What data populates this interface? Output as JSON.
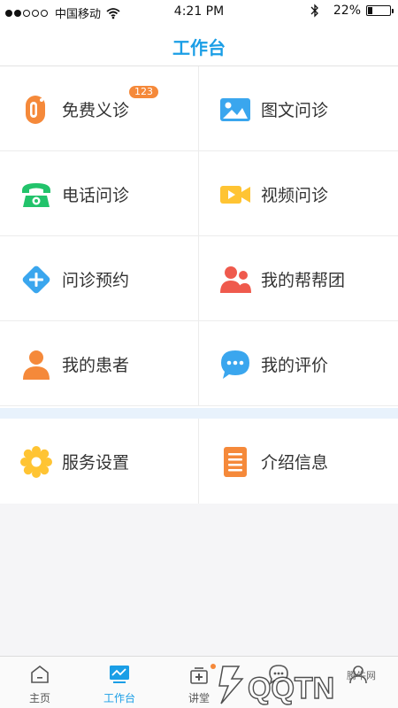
{
  "status_bar": {
    "carrier": "中国移动",
    "time": "4:21 PM",
    "battery_percent": "22%",
    "battery_level": 0.22,
    "signal_bars_filled": 2,
    "signal_bars_total": 5
  },
  "header": {
    "title": "工作台"
  },
  "colors": {
    "accent": "#1a9ee6",
    "orange": "#f5893a",
    "green": "#22c36b",
    "yellow": "#ffc433",
    "red": "#ef5a4d",
    "blue_light": "#3aa6ee"
  },
  "grid_items": [
    {
      "label": "免费义诊",
      "icon": "free-clinic-icon",
      "badge": "123"
    },
    {
      "label": "图文问诊",
      "icon": "image-consult-icon"
    },
    {
      "label": "电话问诊",
      "icon": "phone-icon"
    },
    {
      "label": "视频问诊",
      "icon": "video-icon"
    },
    {
      "label": "问诊预约",
      "icon": "plus-diamond-icon"
    },
    {
      "label": "我的帮帮团",
      "icon": "group-icon"
    },
    {
      "label": "我的患者",
      "icon": "person-icon"
    },
    {
      "label": "我的评价",
      "icon": "chat-bubble-icon"
    }
  ],
  "settings_items": [
    {
      "label": "服务设置",
      "icon": "gear-icon"
    },
    {
      "label": "介绍信息",
      "icon": "document-icon"
    }
  ],
  "tab_bar": {
    "tabs": [
      {
        "label": "主页",
        "icon": "home-icon"
      },
      {
        "label": "工作台",
        "icon": "workbench-icon",
        "active": true
      },
      {
        "label": "讲堂",
        "icon": "classroom-icon"
      },
      {
        "label": "",
        "icon": "message-icon"
      },
      {
        "label": "",
        "icon": "profile-icon"
      }
    ]
  },
  "watermark": {
    "text": "腾牛网",
    "brand": "QQTN"
  }
}
